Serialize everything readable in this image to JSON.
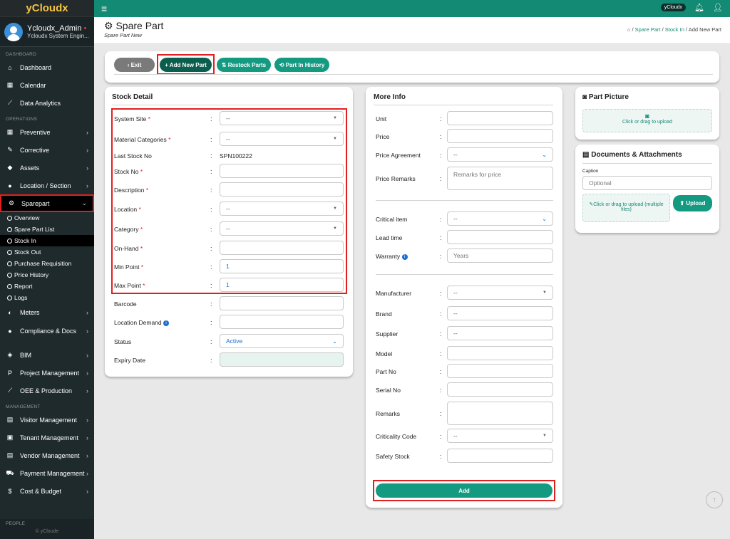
{
  "app": {
    "brand": "yCloudx",
    "user_name": "Ycloudx_Admin",
    "user_dot": "•",
    "user_role": "Ycloudx System Engin...",
    "copyright": "© yCloude"
  },
  "topbar": {
    "pill": "yCloudx"
  },
  "sidebar": {
    "sections": [
      "DASHBOARD",
      "OPERATIONS",
      "MANAGEMENT",
      "PEOPLE"
    ],
    "dash": [
      {
        "label": "Dashboard",
        "icon": "home-icon"
      },
      {
        "label": "Calendar",
        "icon": "calendar-icon"
      },
      {
        "label": "Data Analytics",
        "icon": "chart-icon"
      }
    ],
    "ops": [
      {
        "label": "Preventive"
      },
      {
        "label": "Corrective"
      },
      {
        "label": "Assets"
      },
      {
        "label": "Location / Section"
      },
      {
        "label": "Sparepart"
      }
    ],
    "sub": [
      "Overview",
      "Spare Part List",
      "Stock In",
      "Stock Out",
      "Purchase Requisition",
      "Price History",
      "Report",
      "Logs"
    ],
    "ops2": [
      {
        "label": "Meters"
      },
      {
        "label": "Compliance & Docs"
      },
      {
        "label": "BIM"
      },
      {
        "label": "Project Management"
      },
      {
        "label": "OEE & Production"
      }
    ],
    "mgmt": [
      {
        "label": "Visitor Management"
      },
      {
        "label": "Tenant Management"
      },
      {
        "label": "Vendor Management"
      },
      {
        "label": "Payment Management"
      },
      {
        "label": "Cost & Budget"
      }
    ]
  },
  "page": {
    "title": "Spare Part",
    "subtitle": "Spare Part New",
    "breadcrumb": [
      "Spare Part",
      "Stock In",
      "Add New Part"
    ]
  },
  "toolbar": {
    "exit": "‹ Exit",
    "add": "+ Add New Part",
    "restock": "⇅ Restock Parts",
    "history": "⟲ Part In History"
  },
  "stock": {
    "title": "Stock Detail",
    "system_site": "System Site",
    "material_categories": "Material Categories",
    "last_stock_no": "Last Stock No",
    "last_stock_value": "SPN100222",
    "stock_no": "Stock No",
    "description": "Description",
    "location": "Location",
    "category": "Category",
    "on_hand": "On-Hand",
    "min_point": "Min Point",
    "min_value": "1",
    "max_point": "Max Point",
    "max_value": "1",
    "barcode": "Barcode",
    "location_demand": "Location Demand",
    "status": "Status",
    "status_value": "Active",
    "expiry_date": "Expiry Date",
    "dash": "--",
    "req": "*",
    "colon": ":"
  },
  "more": {
    "title": "More Info",
    "unit": "Unit",
    "price": "Price",
    "price_agreement": "Price Agreement",
    "price_remarks": "Price Remarks",
    "price_remarks_ph": "Remarks for price",
    "critical_item": "Critical item",
    "lead_time": "Lead time",
    "warranty": "Warranty",
    "warranty_ph": "Years",
    "manufacturer": "Manufacturer",
    "brand": "Brand",
    "supplier": "Supplier",
    "model": "Model",
    "part_no": "Part No",
    "serial_no": "Serial No",
    "remarks": "Remarks",
    "criticality_code": "Criticality Code",
    "safety_stock": "Safety Stock",
    "add": "Add"
  },
  "picture": {
    "title": "Part Picture",
    "upload": "Click or drag to upload"
  },
  "docs": {
    "title": "Documents & Attachments",
    "caption": "Caption",
    "caption_ph": "Optional",
    "upload": "Click or drag to upload (multiple files)",
    "upload_btn": "Upload"
  },
  "colors": {
    "brand": "#138a73",
    "sidebar": "#1f2a2d",
    "highlight": "#e0201e"
  }
}
